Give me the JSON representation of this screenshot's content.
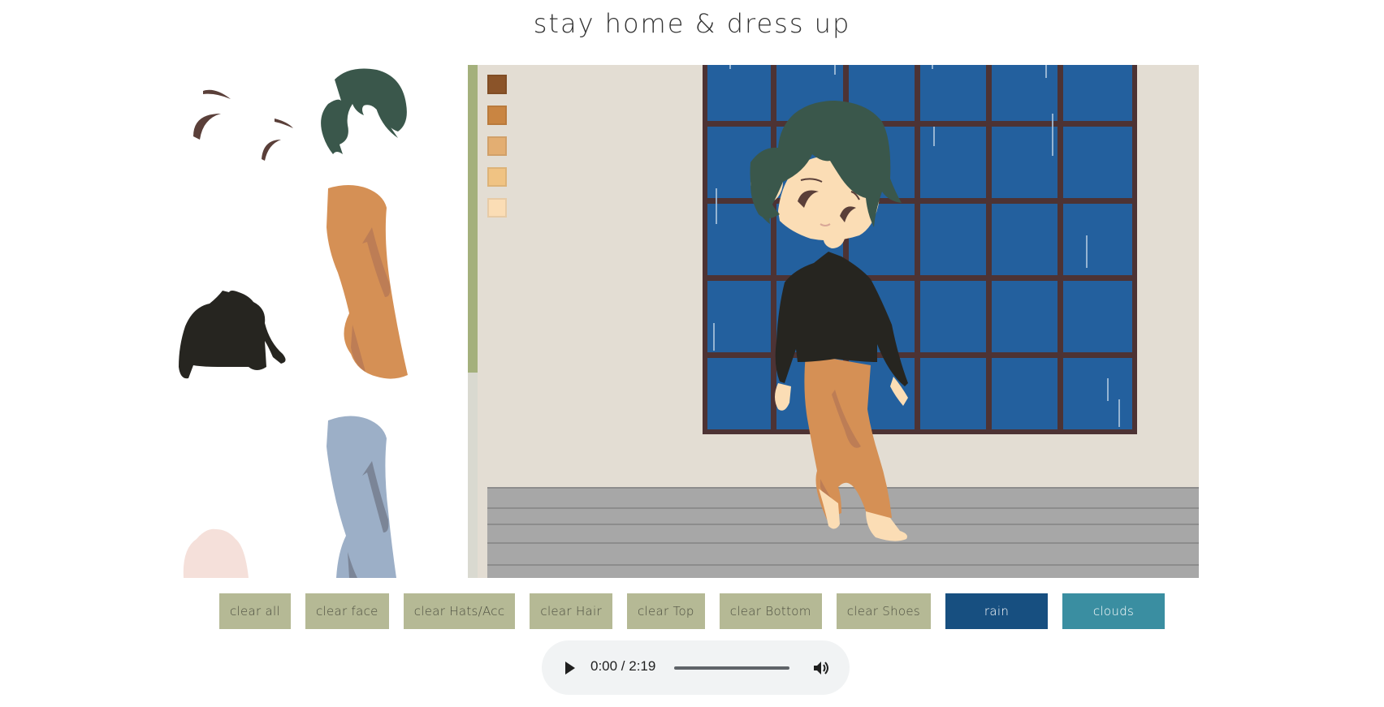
{
  "page": {
    "title": "stay home & dress up"
  },
  "skin_swatches": [
    "#8b5429",
    "#c98542",
    "#e3ae72",
    "#f0c383",
    "#fbddb5"
  ],
  "scroll_position": 0.6,
  "buttons": {
    "clear_all": "clear all",
    "clear_face": "clear face",
    "clear_hats": "clear Hats/Acc",
    "clear_hair": "clear Hair",
    "clear_top": "clear Top",
    "clear_bottom": "clear Bottom",
    "clear_shoes": "clear Shoes",
    "rain": "rain",
    "clouds": "clouds"
  },
  "audio": {
    "time": "0:00 / 2:19",
    "progress": 0
  },
  "colors": {
    "button_bg": "#b5b995",
    "rain_bg": "#174f80",
    "clouds_bg": "#3a8ea1",
    "window_blue": "#23609e",
    "window_frame": "#4d3334",
    "hair": "#3a574b",
    "sweater": "#262520",
    "pants": "#d59055",
    "skin": "#fbddb5"
  },
  "icons": {
    "play": "play-icon",
    "volume": "volume-icon"
  }
}
